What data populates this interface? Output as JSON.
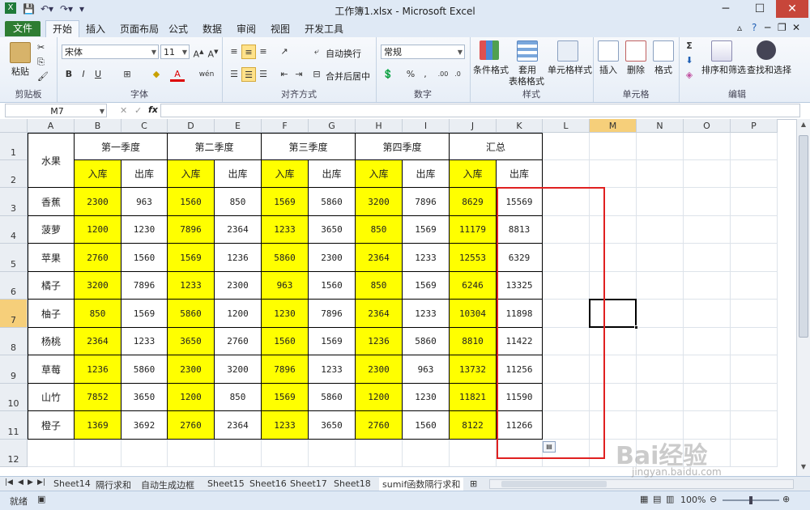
{
  "window": {
    "title": "工作簿1.xlsx - Microsoft Excel",
    "minimize": "─",
    "maximize": "☐",
    "close": "✕"
  },
  "tabs": {
    "file": "文件",
    "items": [
      "开始",
      "插入",
      "页面布局",
      "公式",
      "数据",
      "审阅",
      "视图",
      "开发工具"
    ]
  },
  "ribbon": {
    "clipboard": {
      "paste": "粘贴",
      "label": "剪贴板"
    },
    "font": {
      "name": "宋体",
      "size": "11",
      "bold": "B",
      "italic": "I",
      "underline": "U",
      "wen": "wén",
      "label": "字体"
    },
    "alignment": {
      "wrap": "自动换行",
      "merge": "合并后居中",
      "label": "对齐方式"
    },
    "number": {
      "format": "常规",
      "percent": "%",
      "comma": ",",
      "label": "数字"
    },
    "styles": {
      "conditional_line1": "条件格式",
      "table_line1": "套用",
      "table_line2": "表格格式",
      "cell_styles": "单元格样式",
      "label": "样式"
    },
    "cells": {
      "insert": "插入",
      "delete": "删除",
      "format": "格式",
      "label": "单元格"
    },
    "editing": {
      "sum": "Σ",
      "sort": "排序和筛选",
      "find": "查找和选择",
      "label": "编辑"
    }
  },
  "formula_bar": {
    "name_box": "M7",
    "fx": "fx",
    "value": ""
  },
  "columns": [
    "A",
    "B",
    "C",
    "D",
    "E",
    "F",
    "G",
    "H",
    "I",
    "J",
    "K",
    "L",
    "M",
    "N",
    "O",
    "P"
  ],
  "rows": [
    "1",
    "2",
    "3",
    "4",
    "5",
    "6",
    "7",
    "8",
    "9",
    "10",
    "11",
    "12"
  ],
  "table": {
    "fruit_header": "水果",
    "quarters": [
      "第一季度",
      "第二季度",
      "第三季度",
      "第四季度",
      "汇总"
    ],
    "in_label": "入库",
    "out_label": "出库",
    "data": [
      {
        "fruit": "香蕉",
        "values": [
          "2300",
          "963",
          "1560",
          "850",
          "1569",
          "5860",
          "3200",
          "7896",
          "8629",
          "15569"
        ]
      },
      {
        "fruit": "菠萝",
        "values": [
          "1200",
          "1230",
          "7896",
          "2364",
          "1233",
          "3650",
          "850",
          "1569",
          "11179",
          "8813"
        ]
      },
      {
        "fruit": "苹果",
        "values": [
          "2760",
          "1560",
          "1569",
          "1236",
          "5860",
          "2300",
          "2364",
          "1233",
          "12553",
          "6329"
        ]
      },
      {
        "fruit": "橘子",
        "values": [
          "3200",
          "7896",
          "1233",
          "2300",
          "963",
          "1560",
          "850",
          "1569",
          "6246",
          "13325"
        ]
      },
      {
        "fruit": "柚子",
        "values": [
          "850",
          "1569",
          "5860",
          "1200",
          "1230",
          "7896",
          "2364",
          "1233",
          "10304",
          "11898"
        ]
      },
      {
        "fruit": "杨桃",
        "values": [
          "2364",
          "1233",
          "3650",
          "2760",
          "1560",
          "1569",
          "1236",
          "5860",
          "8810",
          "11422"
        ]
      },
      {
        "fruit": "草莓",
        "values": [
          "1236",
          "5860",
          "2300",
          "3200",
          "7896",
          "1233",
          "2300",
          "963",
          "13732",
          "11256"
        ]
      },
      {
        "fruit": "山竹",
        "values": [
          "7852",
          "3650",
          "1200",
          "850",
          "1569",
          "5860",
          "1200",
          "1230",
          "11821",
          "11590"
        ]
      },
      {
        "fruit": "橙子",
        "values": [
          "1369",
          "3692",
          "2760",
          "2364",
          "1233",
          "3650",
          "2760",
          "1560",
          "8122",
          "11266"
        ]
      }
    ]
  },
  "sheet_tabs": [
    "Sheet14",
    "隔行求和",
    "自动生成边框",
    "Sheet15",
    "Sheet16",
    "Sheet17",
    "Sheet18",
    "sumif函数隔行求和"
  ],
  "status": {
    "ready": "就绪",
    "zoom": "100%"
  },
  "watermark": {
    "brand": "Bai经验",
    "url": "jingyan.baidu.com"
  },
  "colors": {
    "highlight": "#ffff00",
    "annotation": "#e02020",
    "active_header": "#f6cf7a",
    "file_tab": "#2e7d32"
  }
}
